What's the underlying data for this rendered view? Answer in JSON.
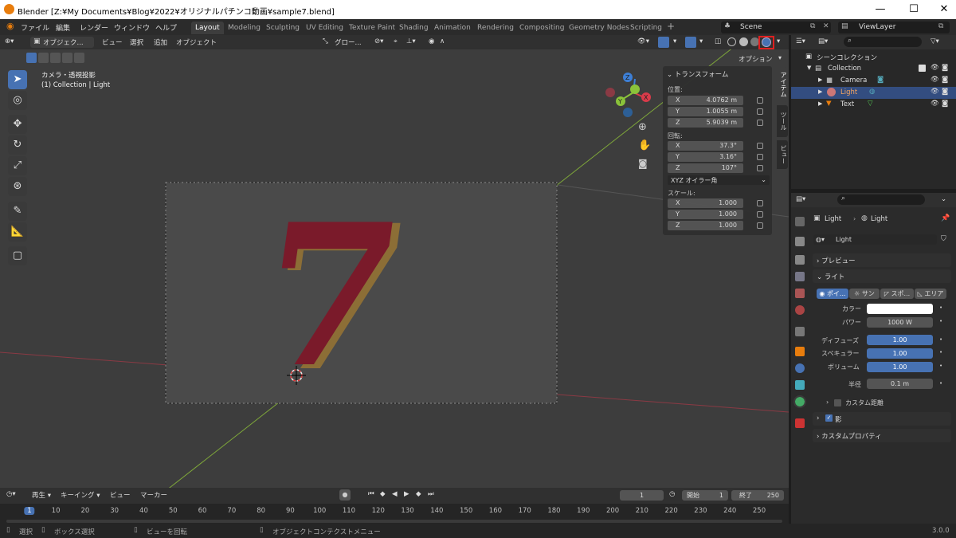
{
  "window": {
    "title": "Blender [Z:¥My Documents¥Blog¥2022¥オリジナルパチンコ動画¥sample7.blend]",
    "minimize": "—",
    "maximize": "☐",
    "close": "✕"
  },
  "menu": [
    "ファイル",
    "編集",
    "レンダー",
    "ウィンドウ",
    "ヘルプ"
  ],
  "workspaces": [
    "Layout",
    "Modeling",
    "Sculpting",
    "UV Editing",
    "Texture Paint",
    "Shading",
    "Animation",
    "Rendering",
    "Compositing",
    "Geometry Nodes",
    "Scripting"
  ],
  "workspace_add": "+",
  "scene": "Scene",
  "view_layer": "ViewLayer",
  "viewport_header": {
    "mode": "オブジェク...",
    "menus": [
      "ビュー",
      "選択",
      "追加",
      "オブジェクト"
    ],
    "orientation": "グロー...",
    "options": "オプション"
  },
  "viewport": {
    "view_name": "カメラ・透視投影",
    "collection_info": "(1) Collection | Light",
    "object_text": "7",
    "colors": {
      "text_fill": "#7a1a2a",
      "text_outline": "#b8862a",
      "x_axis": "#d83b4a",
      "y_axis": "#8ac23a",
      "z_axis": "#3d7fd6",
      "highlight_box": "#e02020"
    }
  },
  "n_panel": {
    "section": "トランスフォーム",
    "location_label": "位置:",
    "location": [
      {
        "axis": "X",
        "value": "4.0762 m"
      },
      {
        "axis": "Y",
        "value": "1.0055 m"
      },
      {
        "axis": "Z",
        "value": "5.9039 m"
      }
    ],
    "rotation_label": "回転:",
    "rotation": [
      {
        "axis": "X",
        "value": "37.3°"
      },
      {
        "axis": "Y",
        "value": "3.16°"
      },
      {
        "axis": "Z",
        "value": "107°"
      }
    ],
    "rotation_mode": "XYZ オイラー角",
    "scale_label": "スケール:",
    "scale": [
      {
        "axis": "X",
        "value": "1.000"
      },
      {
        "axis": "Y",
        "value": "1.000"
      },
      {
        "axis": "Z",
        "value": "1.000"
      }
    ],
    "tabs": [
      "アイテム",
      "ツール",
      "ビュー"
    ]
  },
  "outliner": {
    "root": "シーンコレクション",
    "collection": "Collection",
    "items": [
      {
        "name": "Camera",
        "selected": false
      },
      {
        "name": "Light",
        "selected": true
      },
      {
        "name": "Text",
        "selected": false
      }
    ]
  },
  "properties": {
    "breadcrumb_object": "Light",
    "breadcrumb_data": "Light",
    "datablock": "Light",
    "sections": {
      "preview": "プレビュー",
      "light": "ライト",
      "custom_distance": "カスタム距離",
      "shadow": "影",
      "custom_props": "カスタムプロパティ"
    },
    "light_types": [
      "ポイ...",
      "サン",
      "スポ...",
      "エリア"
    ],
    "color_label": "カラー",
    "power_label": "パワー",
    "power": "1000 W",
    "diffuse_label": "ディフューズ",
    "diffuse": "1.00",
    "specular_label": "スペキュラー",
    "specular": "1.00",
    "volume_label": "ボリューム",
    "volume": "1.00",
    "radius_label": "半径",
    "radius": "0.1 m"
  },
  "timeline": {
    "menus": [
      "再生",
      "キーイング",
      "ビュー",
      "マーカー"
    ],
    "current_frame": "1",
    "start_label": "開始",
    "start": "1",
    "end_label": "終了",
    "end": "250",
    "ticks": [
      "1",
      "10",
      "20",
      "30",
      "40",
      "50",
      "60",
      "70",
      "80",
      "90",
      "100",
      "110",
      "120",
      "130",
      "140",
      "150",
      "160",
      "170",
      "180",
      "190",
      "200",
      "210",
      "220",
      "230",
      "240",
      "250"
    ]
  },
  "statusbar": {
    "select": "選択",
    "box_select": "ボックス選択",
    "rotate_view": "ビューを回転",
    "context_menu": "オブジェクトコンテクストメニュー",
    "version": "3.0.0"
  }
}
